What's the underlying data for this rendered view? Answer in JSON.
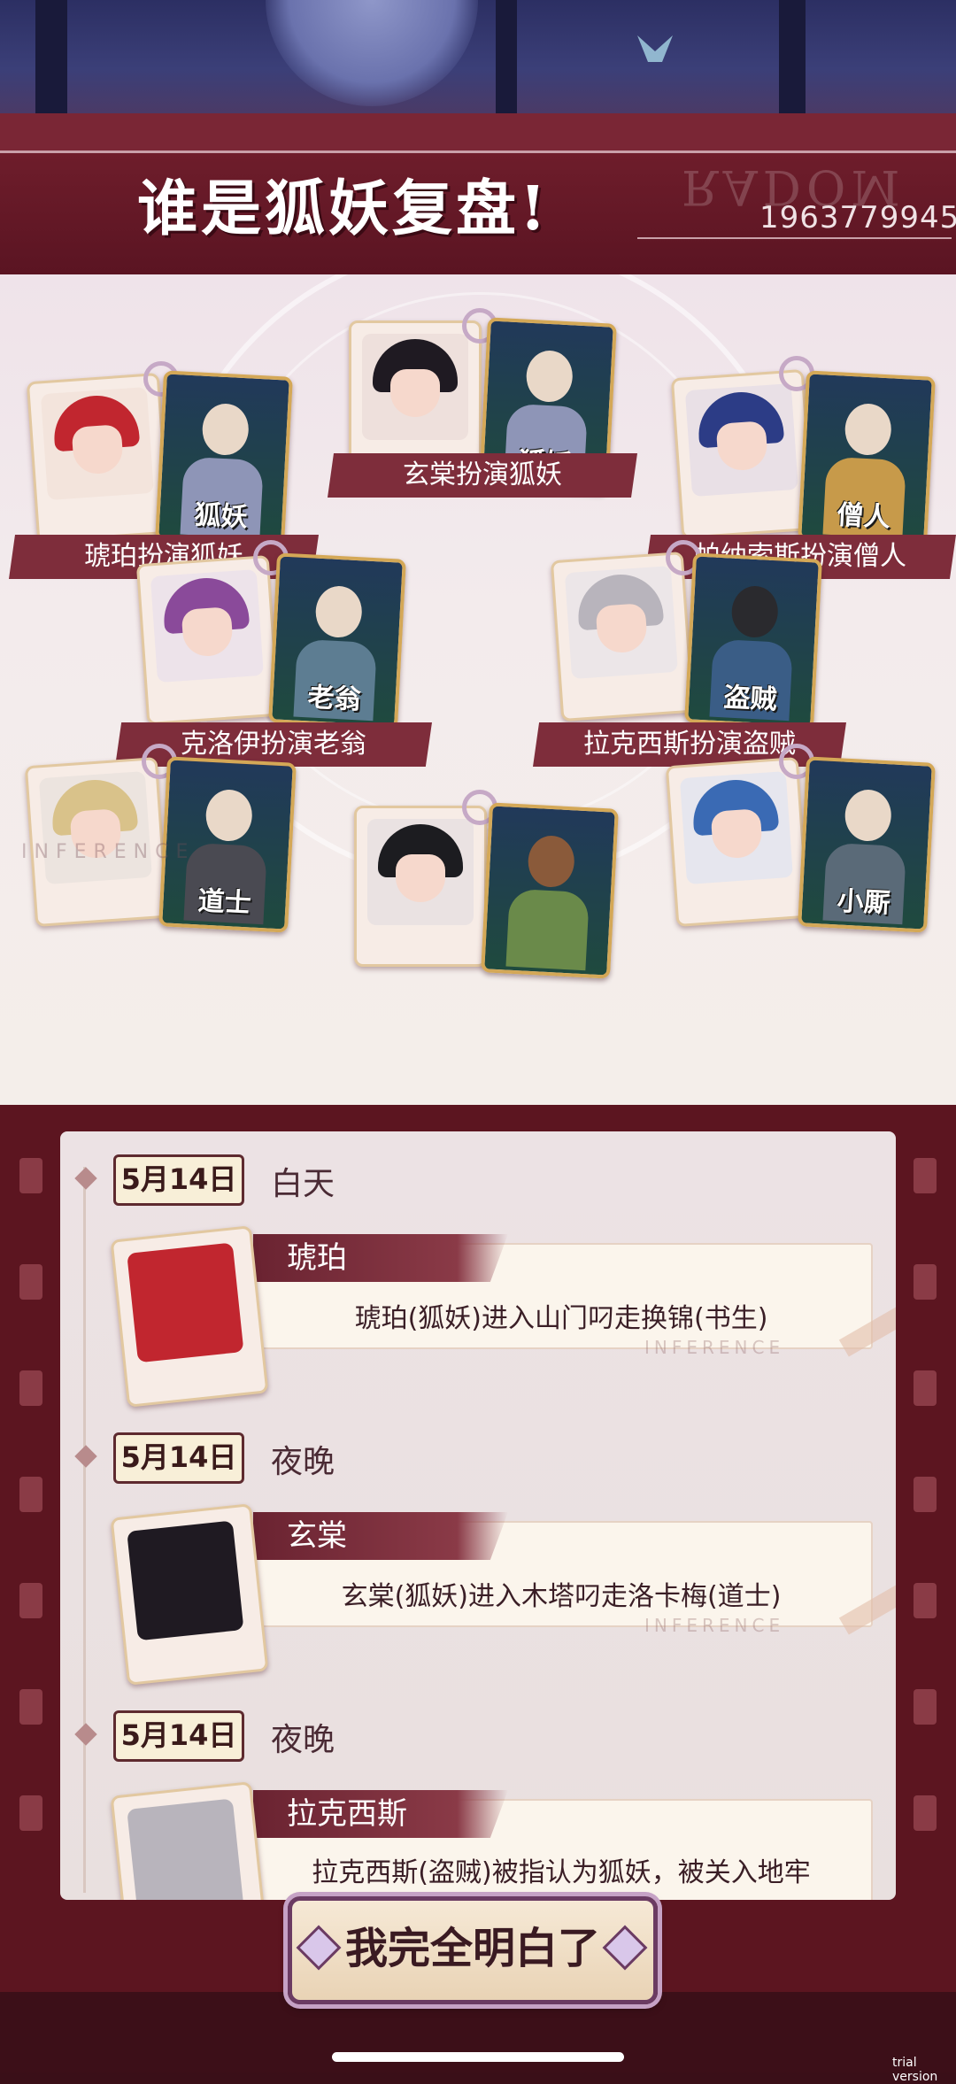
{
  "header": {
    "title": "谁是狐妖复盘!",
    "watermark": "RADOM",
    "room_id": "1963779945"
  },
  "pairs": [
    {
      "label": "琥珀扮演狐妖",
      "role": "狐妖"
    },
    {
      "label": "玄棠扮演狐妖",
      "role": "狐妖"
    },
    {
      "label": "帕纳索斯扮演僧人",
      "role": "僧人"
    },
    {
      "label": "克洛伊扮演老翁",
      "role": "老翁"
    },
    {
      "label": "拉克西斯扮演盗贼",
      "role": "盗贼"
    },
    {
      "label": "",
      "role": "道士"
    },
    {
      "label": "",
      "role": ""
    },
    {
      "label": "",
      "role": "小厮"
    }
  ],
  "watermark_inference": "INFERENCE",
  "log": [
    {
      "date": "5月14日",
      "phase": "白天",
      "name": "琥珀",
      "text": "琥珀(狐妖)进入山门叼走换锦(书生)"
    },
    {
      "date": "5月14日",
      "phase": "夜晚",
      "name": "玄棠",
      "text": "玄棠(狐妖)进入木塔叼走洛卡梅(道士)"
    },
    {
      "date": "5月14日",
      "phase": "夜晚",
      "name": "拉克西斯",
      "text": "拉克西斯(盗贼)被指认为狐妖，被关入地牢"
    }
  ],
  "confirm_button": "我完全明白了",
  "trial_label": "trial version",
  "colors": {
    "frame": "#7a2635",
    "film": "#5c1520",
    "label_bg": "#7e2d3b",
    "card_gold": "#d4a857"
  }
}
